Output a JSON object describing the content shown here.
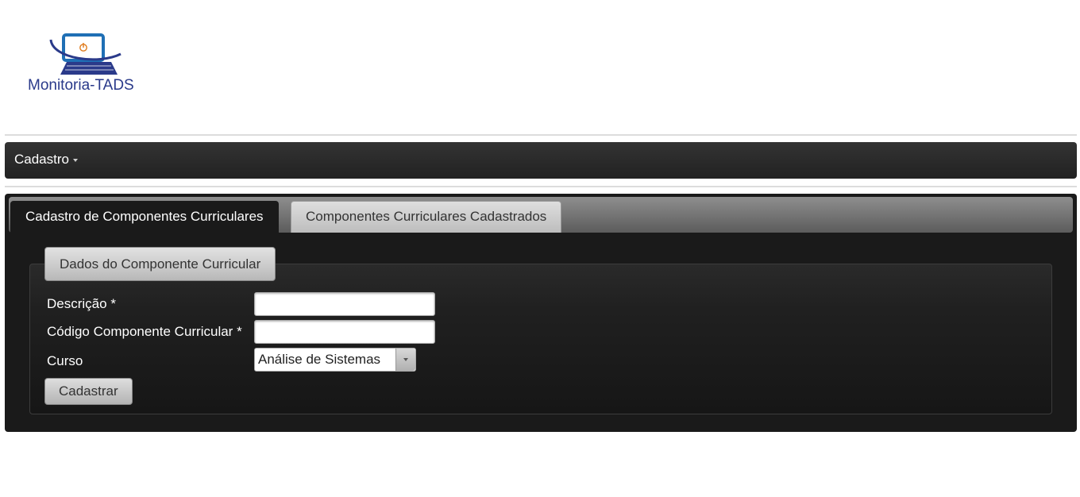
{
  "logo": {
    "text": "Monitoria-TADS",
    "icon": "laptop-power-icon",
    "colors": {
      "screen": "#1f6fb5",
      "power": "#e07a1a",
      "keyboard": "#2a3a8a",
      "text": "#2a3a8a"
    }
  },
  "menubar": {
    "items": [
      {
        "label": "Cadastro",
        "icon": "chevron-down-icon"
      }
    ]
  },
  "tabs": [
    {
      "label": "Cadastro de Componentes Curriculares",
      "active": true
    },
    {
      "label": "Componentes Curriculares Cadastrados",
      "active": false
    }
  ],
  "form": {
    "legend": "Dados do Componente Curricular",
    "fields": [
      {
        "label": "Descrição",
        "required_mark": "*",
        "value": ""
      },
      {
        "label": "Código Componente Curricular",
        "required_mark": "*",
        "value": ""
      }
    ],
    "curso": {
      "label": "Curso",
      "selected": "Análise de Sistemas",
      "icon": "triangle-down-icon"
    },
    "submit_label": "Cadastrar"
  },
  "colors": {
    "menubar": "#2b2b2b",
    "panel": "#1a1a1a",
    "tab_strip": "#7a7a7a",
    "button": "#c8c8c8"
  }
}
